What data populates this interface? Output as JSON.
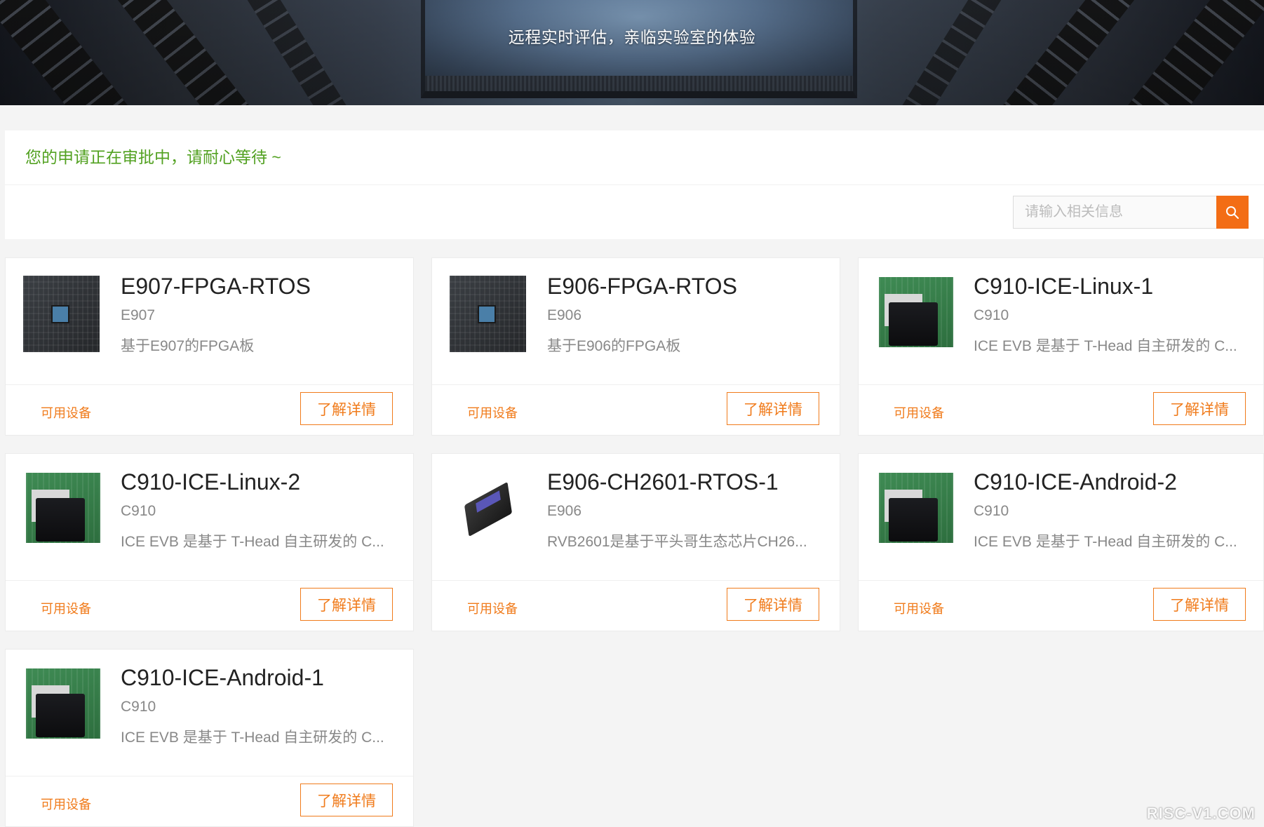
{
  "hero": {
    "slogan": "远程实时评估，亲临实验室的体验"
  },
  "notice": "您的申请正在审批中，请耐心等待 ~",
  "search": {
    "placeholder": "请输入相关信息",
    "icon": "search-icon",
    "accent": "#f36d15"
  },
  "cards": [
    {
      "name": "E907-FPGA-RTOS",
      "chip": "E907",
      "desc": "基于E907的FPGA板",
      "status": "可用设备",
      "button": "了解详情",
      "image": "fpga-board-image"
    },
    {
      "name": "E906-FPGA-RTOS",
      "chip": "E906",
      "desc": "基于E906的FPGA板",
      "status": "可用设备",
      "button": "了解详情",
      "image": "fpga-board-image"
    },
    {
      "name": "C910-ICE-Linux-1",
      "chip": "C910",
      "desc": "ICE EVB 是基于 T-Head 自主研发的 C...",
      "status": "可用设备",
      "button": "了解详情",
      "image": "ice-evb-board-image"
    },
    {
      "name": "C910-ICE-Linux-2",
      "chip": "C910",
      "desc": "ICE EVB 是基于 T-Head 自主研发的 C...",
      "status": "可用设备",
      "button": "了解详情",
      "image": "ice-evb-board-image"
    },
    {
      "name": "E906-CH2601-RTOS-1",
      "chip": "E906",
      "desc": "RVB2601是基于平头哥生态芯片CH26...",
      "status": "可用设备",
      "button": "了解详情",
      "image": "rvb2601-board-image"
    },
    {
      "name": "C910-ICE-Android-2",
      "chip": "C910",
      "desc": "ICE EVB 是基于 T-Head 自主研发的 C...",
      "status": "可用设备",
      "button": "了解详情",
      "image": "ice-evb-board-image"
    },
    {
      "name": "C910-ICE-Android-1",
      "chip": "C910",
      "desc": "ICE EVB 是基于 T-Head 自主研发的 C...",
      "status": "可用设备",
      "button": "了解详情",
      "image": "ice-evb-board-image"
    }
  ],
  "colors": {
    "notice": "#52a121",
    "status": "#f07b1b",
    "button": "#f07b1b"
  },
  "watermark": "RISC-V1.COM"
}
